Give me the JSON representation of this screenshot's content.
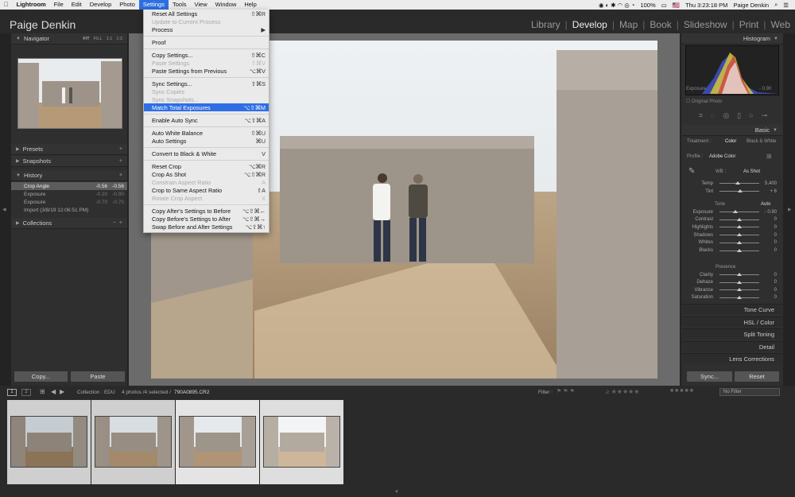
{
  "menubar": {
    "apple": "",
    "items": [
      "Lightroom",
      "File",
      "Edit",
      "Develop",
      "Photo",
      "Settings",
      "Tools",
      "View",
      "Window",
      "Help"
    ],
    "active_index": 5,
    "battery": "100%",
    "flag": "🇺🇸",
    "clock": "Thu 3:23:18 PM",
    "user": "Paige Denkin"
  },
  "identity_plate": "Paige Denkin",
  "modules": [
    "Library",
    "Develop",
    "Map",
    "Book",
    "Slideshow",
    "Print",
    "Web"
  ],
  "active_module": "Develop",
  "left_panel": {
    "navigator": {
      "title": "Navigator",
      "zoom_options": [
        "FIT",
        "FILL",
        "1:1",
        "1:3"
      ]
    },
    "presets": "Presets",
    "snapshots": "Snapshots",
    "history": {
      "title": "History",
      "items": [
        {
          "label": "Crop Angle",
          "a": "-0.56",
          "b": "-0.56"
        },
        {
          "label": "Exposure",
          "a": "-0.20",
          "b": "-0.90"
        },
        {
          "label": "Exposure",
          "a": "-0.70",
          "b": "-0.70"
        },
        {
          "label": "Import (3/8/19 12:06:51 PM)",
          "a": "",
          "b": ""
        }
      ]
    },
    "collections": "Collections",
    "copy_button": "Copy...",
    "paste_button": "Paste"
  },
  "settings_menu": [
    {
      "label": "Reset All Settings",
      "sc": "⇧⌘R",
      "dis": false
    },
    {
      "label": "Update to Current Process",
      "sc": "",
      "dis": true
    },
    {
      "label": "Process",
      "sc": "▶",
      "dis": false
    },
    {
      "sep": true
    },
    {
      "label": "Proof",
      "sc": "",
      "dis": false
    },
    {
      "sep": true
    },
    {
      "label": "Copy Settings...",
      "sc": "⇧⌘C",
      "dis": false
    },
    {
      "label": "Paste Settings",
      "sc": "⇧⌘V",
      "dis": true
    },
    {
      "label": "Paste Settings from Previous",
      "sc": "⌥⌘V",
      "dis": false
    },
    {
      "sep": true
    },
    {
      "label": "Sync Settings...",
      "sc": "⇧⌘S",
      "dis": false
    },
    {
      "label": "Sync Copies",
      "sc": "",
      "dis": true
    },
    {
      "label": "Sync Snapshots...",
      "sc": "",
      "dis": true
    },
    {
      "label": "Match Total Exposures",
      "sc": "⌥⇧⌘M",
      "dis": false,
      "hl": true
    },
    {
      "sep": true
    },
    {
      "label": "Enable Auto Sync",
      "sc": "⌥⇧⌘A",
      "dis": false
    },
    {
      "sep": true
    },
    {
      "label": "Auto White Balance",
      "sc": "⇧⌘U",
      "dis": false
    },
    {
      "label": "Auto Settings",
      "sc": "⌘U",
      "dis": false
    },
    {
      "sep": true
    },
    {
      "label": "Convert to Black & White",
      "sc": "V",
      "dis": false
    },
    {
      "sep": true
    },
    {
      "label": "Reset Crop",
      "sc": "⌥⌘R",
      "dis": false
    },
    {
      "label": "Crop As Shot",
      "sc": "⌥⇧⌘R",
      "dis": false
    },
    {
      "label": "Constrain Aspect Ratio",
      "sc": "A",
      "dis": true
    },
    {
      "label": "Crop to Same Aspect Ratio",
      "sc": "⇧A",
      "dis": false
    },
    {
      "label": "Rotate Crop Aspect",
      "sc": "X",
      "dis": true
    },
    {
      "sep": true
    },
    {
      "label": "Copy After's Settings to Before",
      "sc": "⌥⇧⌘←",
      "dis": false
    },
    {
      "label": "Copy Before's Settings to After",
      "sc": "⌥⇧⌘→",
      "dis": false
    },
    {
      "label": "Swap Before and After Settings",
      "sc": "⌥⇧⌘↑",
      "dis": false
    }
  ],
  "right_panel": {
    "histogram": "Histogram",
    "exposure_label": "Exposure",
    "exposure_value": "- 0.90",
    "original_photo": "Original Photo",
    "basic": "Basic",
    "treatment": "Treatment :",
    "color": "Color",
    "bw": "Black & White",
    "profile": "Profile :",
    "profile_value": "Adobe Color",
    "wb": "WB :",
    "wb_value": "As Shot",
    "tone": "Tone",
    "auto": "Auto",
    "presence": "Presence",
    "sliders_wb": [
      {
        "label": "Temp",
        "value": "5,400",
        "pos": 0.45
      },
      {
        "label": "Tint",
        "value": "+ 6",
        "pos": 0.52
      }
    ],
    "sliders_tone": [
      {
        "label": "Exposure",
        "value": "- 0.90",
        "pos": 0.4
      },
      {
        "label": "Contrast",
        "value": "0",
        "pos": 0.5
      },
      {
        "label": "Highlights",
        "value": "0",
        "pos": 0.5
      },
      {
        "label": "Shadows",
        "value": "0",
        "pos": 0.5
      },
      {
        "label": "Whites",
        "value": "0",
        "pos": 0.5
      },
      {
        "label": "Blacks",
        "value": "0",
        "pos": 0.5
      }
    ],
    "sliders_presence": [
      {
        "label": "Clarity",
        "value": "0",
        "pos": 0.5
      },
      {
        "label": "Dehaze",
        "value": "0",
        "pos": 0.5
      },
      {
        "label": "Vibrance",
        "value": "0",
        "pos": 0.5
      },
      {
        "label": "Saturation",
        "value": "0",
        "pos": 0.5
      }
    ],
    "sections": [
      "Tone Curve",
      "HSL / Color",
      "Split Toning",
      "Detail",
      "Lens Corrections"
    ],
    "sync_button": "Sync...",
    "reset_button": "Reset"
  },
  "filmbar": {
    "page1": "1",
    "page2": "2",
    "source": "Collection : EDU",
    "count": "4 photos /4 selected /",
    "filename": "790A0895.CR2",
    "filter_label": "Filter :",
    "filter_value": "No Filter"
  }
}
